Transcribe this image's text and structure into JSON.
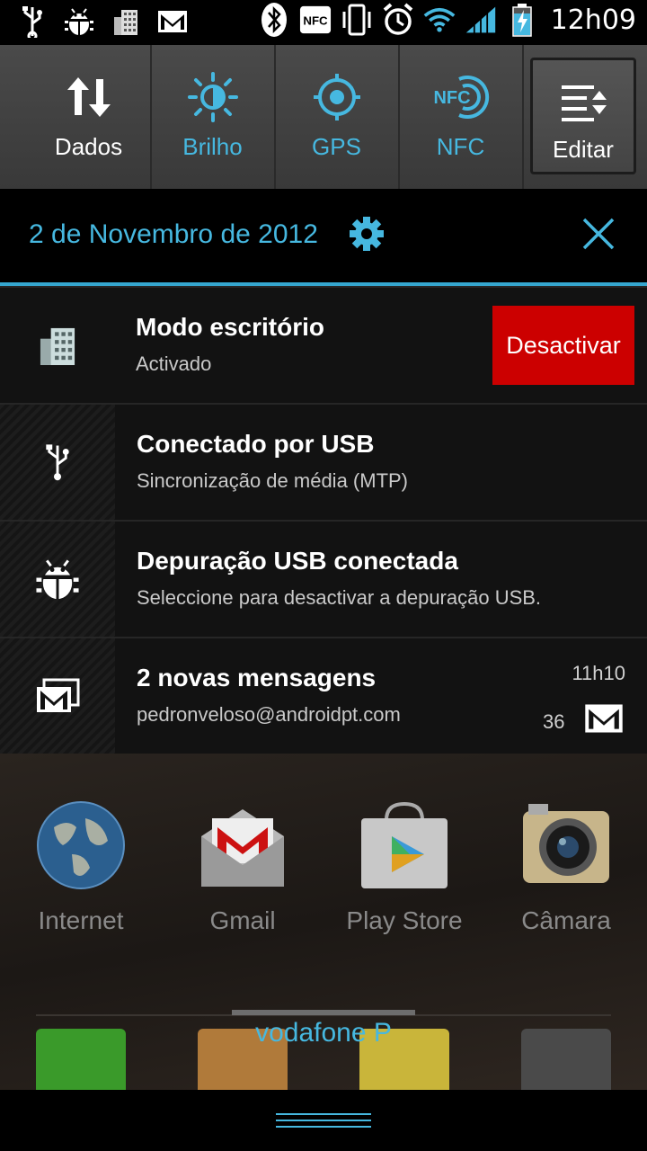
{
  "status_bar": {
    "left_icons": [
      "usb-icon",
      "android-debug-icon",
      "office-building-icon",
      "gmail-icon"
    ],
    "right_icons": [
      "bluetooth-icon",
      "nfc-icon",
      "vibrate-icon",
      "alarm-icon",
      "wifi-icon",
      "signal-icon",
      "battery-charging-icon"
    ],
    "time": "12h09"
  },
  "quick_settings": [
    {
      "label": "Dados",
      "icon": "data-transfer-icon",
      "active": false
    },
    {
      "label": "Brilho",
      "icon": "brightness-icon",
      "active": true
    },
    {
      "label": "GPS",
      "icon": "gps-icon",
      "active": true
    },
    {
      "label": "NFC",
      "icon": "nfc-icon",
      "active": true
    },
    {
      "label": "Editar",
      "icon": "edit-list-icon",
      "active": false
    }
  ],
  "header": {
    "date": "2 de Novembro de 2012"
  },
  "notifications": [
    {
      "title": "Modo escritório",
      "subtitle": "Activado",
      "icon": "office-building-icon",
      "action": "Desactivar"
    },
    {
      "title": "Conectado por USB",
      "subtitle": "Sincronização de média (MTP)",
      "icon": "usb-icon"
    },
    {
      "title": "Depuração USB conectada",
      "subtitle": "Seleccione para desactivar a depuração USB.",
      "icon": "android-debug-icon"
    },
    {
      "title": "2 novas mensagens",
      "subtitle": "pedronveloso@androidpt.com",
      "icon": "gmail-stack-icon",
      "time": "11h10",
      "count": "36"
    }
  ],
  "home": {
    "apps": [
      {
        "label": "Internet",
        "icon": "globe-icon"
      },
      {
        "label": "Gmail",
        "icon": "gmail-app-icon"
      },
      {
        "label": "Play Store",
        "icon": "play-store-icon"
      },
      {
        "label": "Câmara",
        "icon": "camera-icon"
      }
    ],
    "carrier": "vodafone P"
  },
  "colors": {
    "accent": "#46b8e0",
    "disable_button": "#cc0000"
  }
}
